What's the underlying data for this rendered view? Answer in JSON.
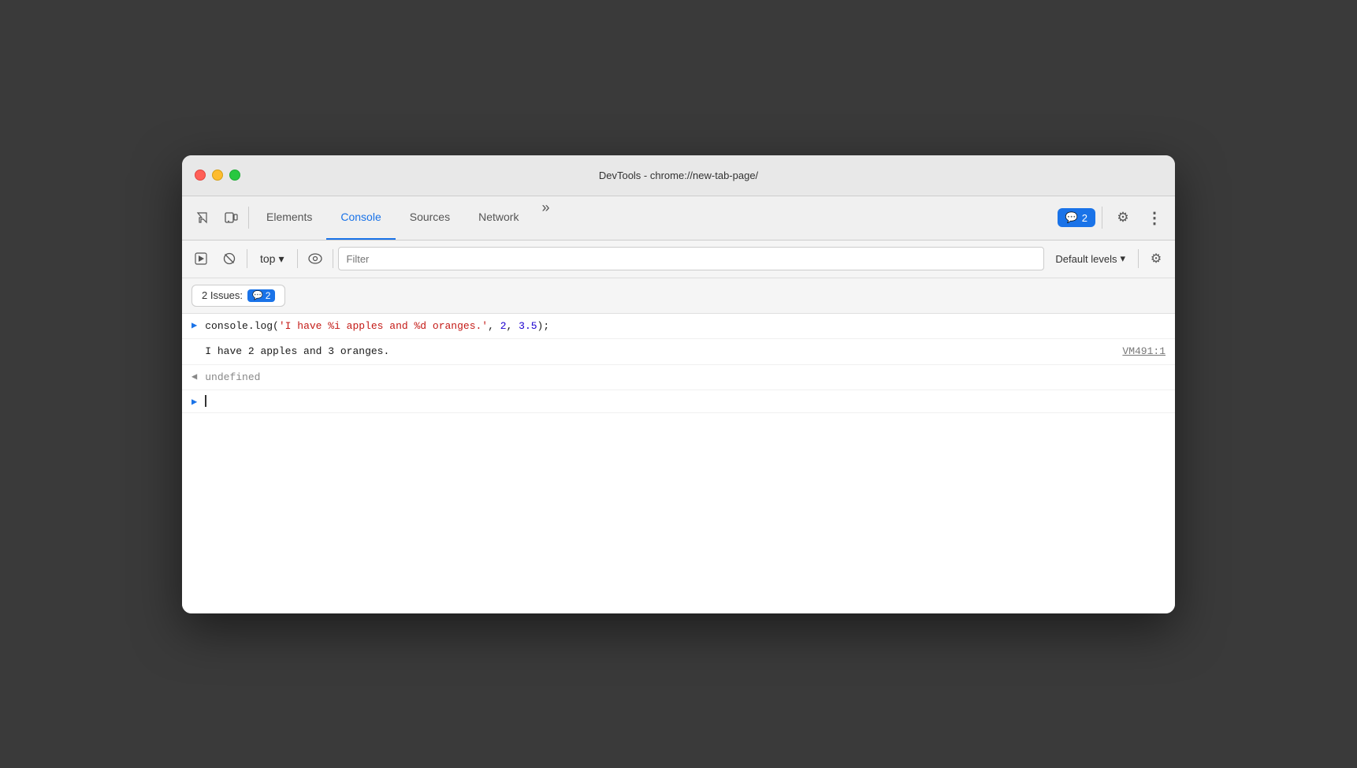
{
  "window": {
    "title": "DevTools - chrome://new-tab-page/"
  },
  "tabs": {
    "items": [
      {
        "id": "elements",
        "label": "Elements",
        "active": false
      },
      {
        "id": "console",
        "label": "Console",
        "active": true
      },
      {
        "id": "sources",
        "label": "Sources",
        "active": false
      },
      {
        "id": "network",
        "label": "Network",
        "active": false
      }
    ],
    "more_label": "»",
    "issues_count": "2",
    "issues_icon": "💬"
  },
  "toolbar": {
    "top_label": "top",
    "filter_placeholder": "Filter",
    "default_levels_label": "Default levels"
  },
  "issues_bar": {
    "label": "2 Issues:",
    "count": "2"
  },
  "console_entries": [
    {
      "id": "log-call",
      "arrow": ">",
      "arrow_color": "blue",
      "code_parts": [
        {
          "text": "console.log(",
          "color": "default"
        },
        {
          "text": "'I have %i apples and %d oranges.'",
          "color": "red"
        },
        {
          "text": ", ",
          "color": "default"
        },
        {
          "text": "2",
          "color": "blue"
        },
        {
          "text": ", ",
          "color": "default"
        },
        {
          "text": "3.5",
          "color": "blue"
        },
        {
          "text": ");",
          "color": "default"
        }
      ]
    },
    {
      "id": "log-output",
      "arrow": "",
      "output_text": "I have 2 apples and 3 oranges.",
      "vm_link": "VM491:1"
    },
    {
      "id": "undefined",
      "arrow": "←",
      "arrow_color": "gray",
      "text": "undefined",
      "text_color": "gray"
    },
    {
      "id": "prompt",
      "arrow": ">",
      "arrow_color": "blue",
      "is_prompt": true
    }
  ],
  "settings": {
    "gear_icon": "⚙"
  }
}
